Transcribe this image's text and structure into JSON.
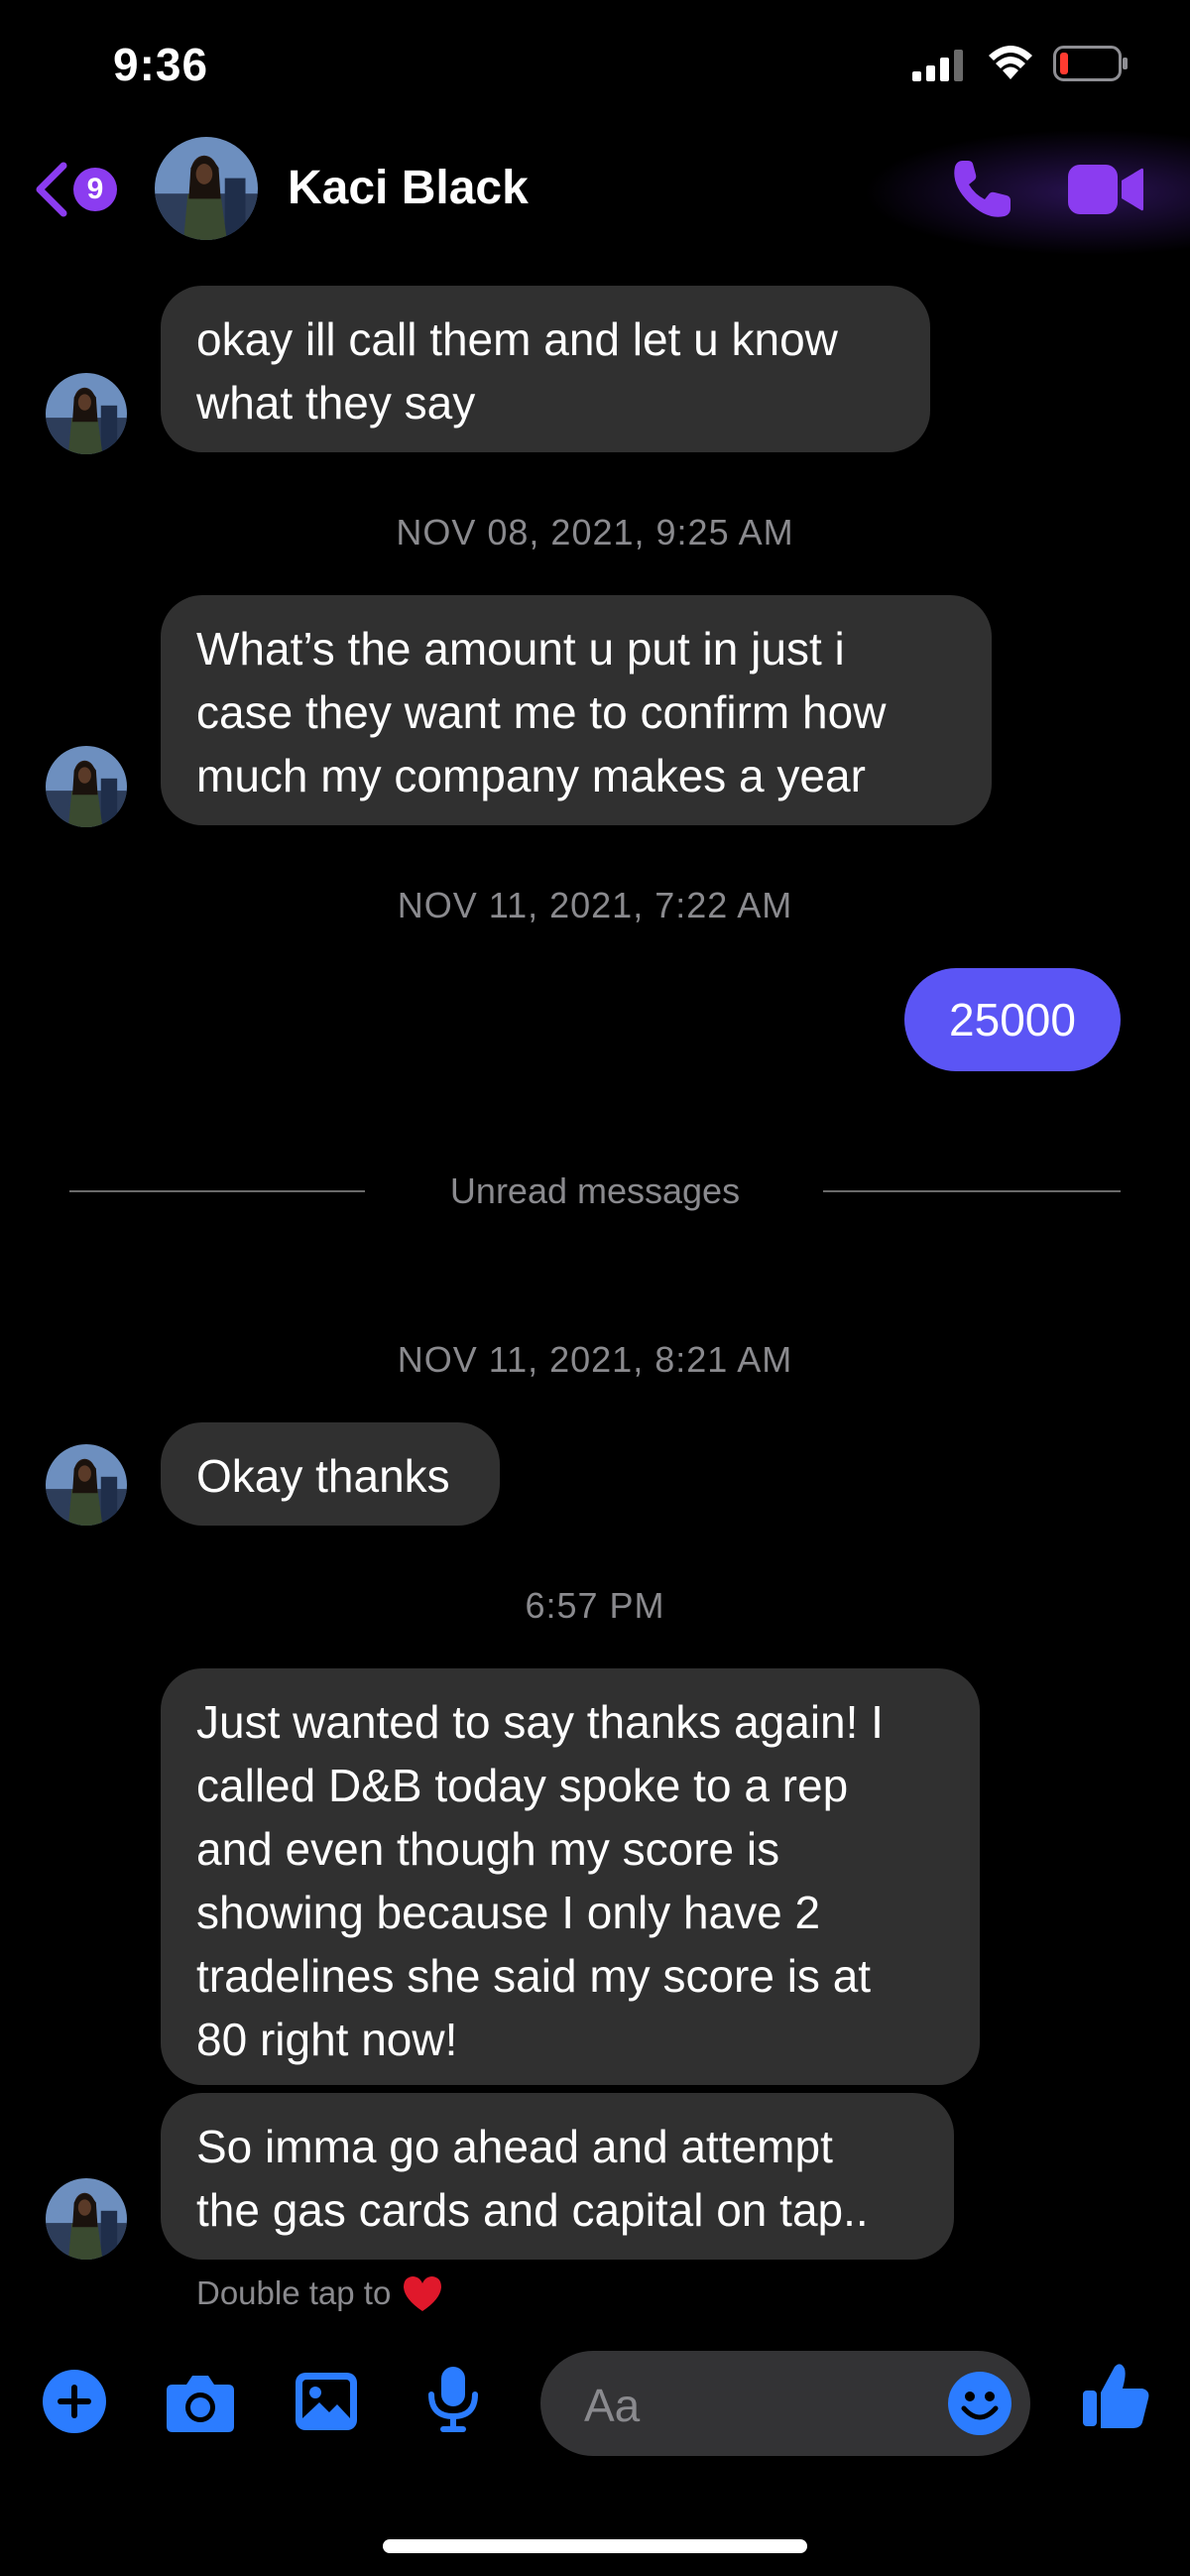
{
  "status_bar": {
    "time": "9:36"
  },
  "header": {
    "unread_count": "9",
    "contact_name": "Kaci Black",
    "icons": {
      "back": "chevron-left-icon",
      "call": "phone-icon",
      "video": "video-camera-icon"
    }
  },
  "messages": [
    {
      "from": "them",
      "text": "okay ill call them and let u know\nwhat they say"
    },
    {
      "timestamp": "NOV 08, 2021, 9:25 AM"
    },
    {
      "from": "them",
      "text": "What’s the amount u put in just i\ncase they want me to confirm how\nmuch my company makes a year"
    },
    {
      "timestamp": "NOV 11, 2021, 7:22 AM"
    },
    {
      "from": "me",
      "text": "25000"
    },
    {
      "divider": "Unread messages"
    },
    {
      "timestamp": "NOV 11, 2021, 8:21 AM"
    },
    {
      "from": "them",
      "text": "Okay thanks"
    },
    {
      "timestamp": "6:57 PM"
    },
    {
      "from": "them",
      "text": "Just wanted to say thanks again! I\ncalled D&B today spoke to a rep\nand even though my score is\nshowing because I only have 2\ntradelines she said my score is at\n80 right now!"
    },
    {
      "from": "them",
      "text": "So imma go ahead and attempt\nthe gas cards and capital on tap.."
    }
  ],
  "reaction_hint": "Double tap to",
  "composer": {
    "placeholder": "Aa",
    "icons": [
      "plus-icon",
      "camera-icon",
      "photo-icon",
      "microphone-icon",
      "emoji-icon",
      "thumbs-up-icon"
    ]
  },
  "colors": {
    "accent": "#8b3cf0",
    "composer_blue": "#2b7cff",
    "my_bubble": "#5b55f5",
    "their_bubble": "#303030"
  }
}
